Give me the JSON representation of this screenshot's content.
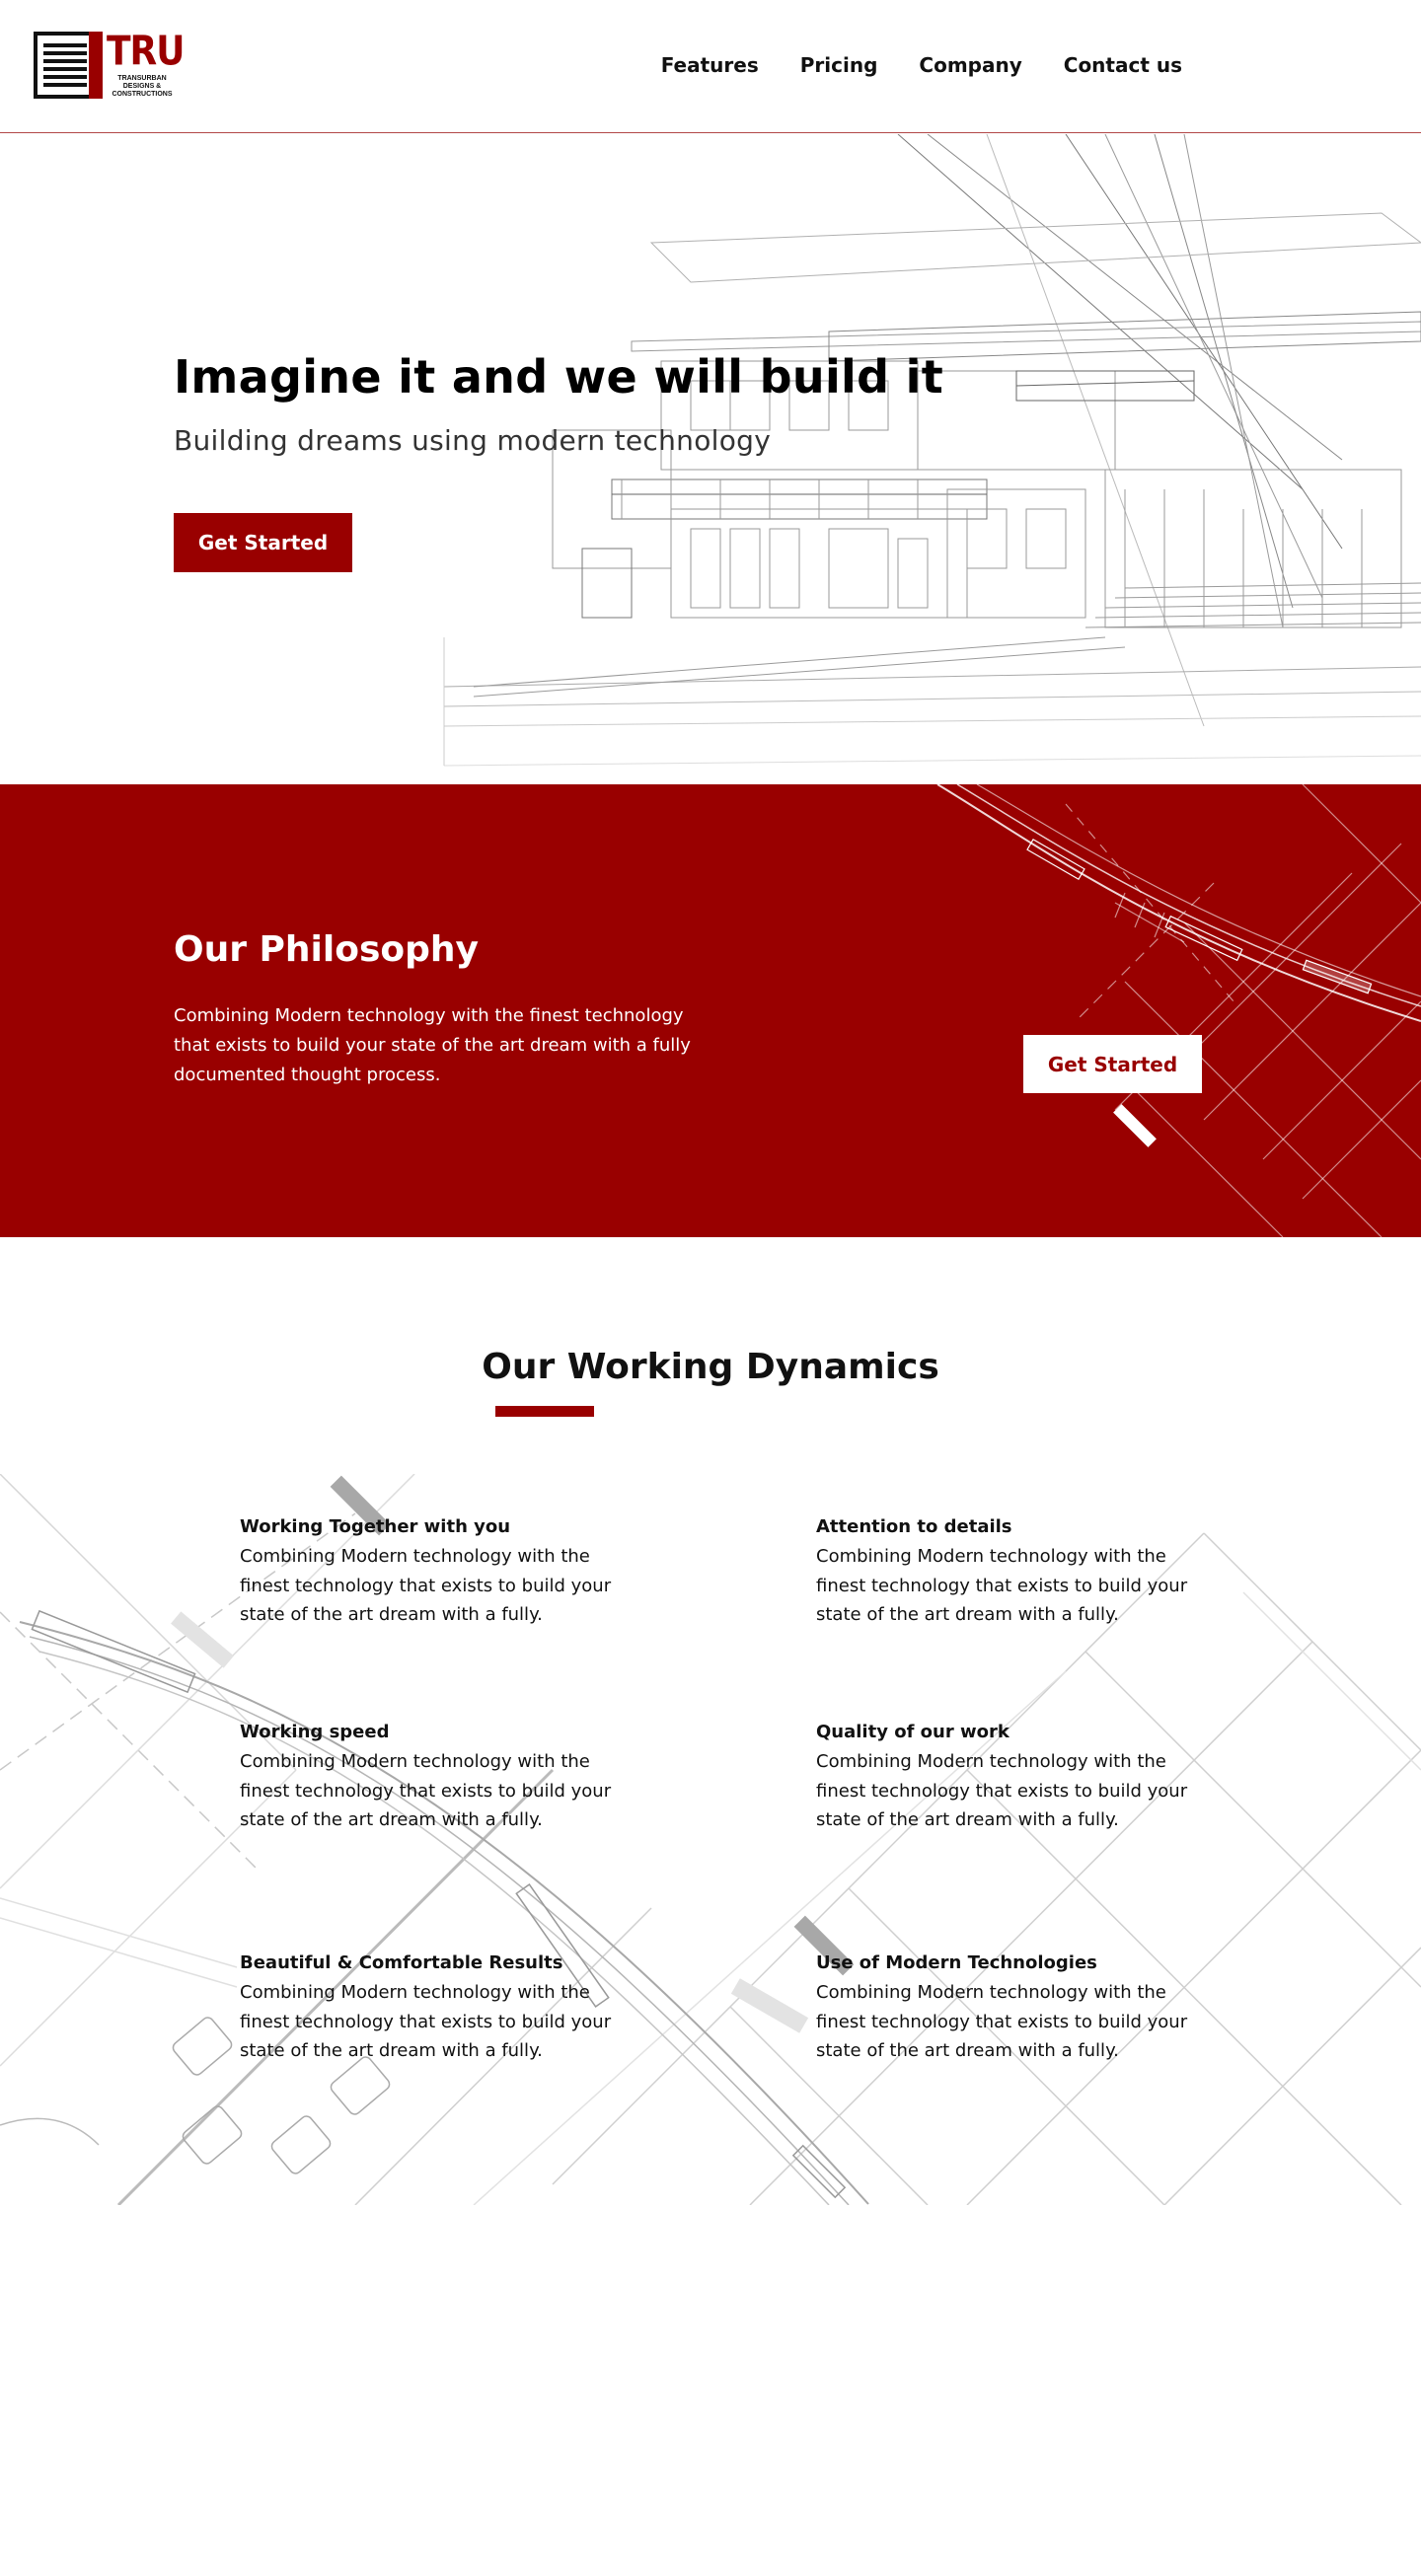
{
  "brand": {
    "logo_word": "TRU",
    "logo_subtitle": "TRANSURBAN DESIGNS & CONSTRUCTIONS"
  },
  "nav": {
    "items": [
      {
        "label": "Features"
      },
      {
        "label": "Pricing"
      },
      {
        "label": "Company"
      },
      {
        "label": "Contact us"
      }
    ]
  },
  "hero": {
    "title": "Imagine it and we will build it",
    "subtitle": "Building dreams using modern technology",
    "cta_label": "Get Started"
  },
  "philosophy": {
    "title": "Our Philosophy",
    "text": "Combining Modern technology with the finest technology that exists to build your state of the art dream with a fully documented thought process.",
    "cta_label": "Get Started"
  },
  "dynamics": {
    "title": "Our Working Dynamics",
    "features": [
      {
        "title": "Working Together with you",
        "text": "Combining Modern technology with the finest technology that exists to build your state of the art dream with a fully."
      },
      {
        "title": "Attention to details",
        "text": "Combining Modern technology with the finest technology that exists to build your state of the art dream with a fully."
      },
      {
        "title": "Working speed",
        "text": "Combining Modern technology with the finest technology that exists to build your state of the art dream with a fully."
      },
      {
        "title": "Quality of our work",
        "text": "Combining Modern technology with the finest technology that exists to build your state of the art dream with a fully."
      },
      {
        "title": "Beautiful & Comfortable Results",
        "text": "Combining Modern technology with the finest technology that exists to build your state of the art dream with a fully."
      },
      {
        "title": "Use of Modern Technologies",
        "text": "Combining Modern technology with the finest technology that exists to build your state of the art dream with a fully."
      }
    ]
  },
  "colors": {
    "brand_red": "#990000",
    "text_dark": "#111111",
    "white": "#ffffff"
  }
}
